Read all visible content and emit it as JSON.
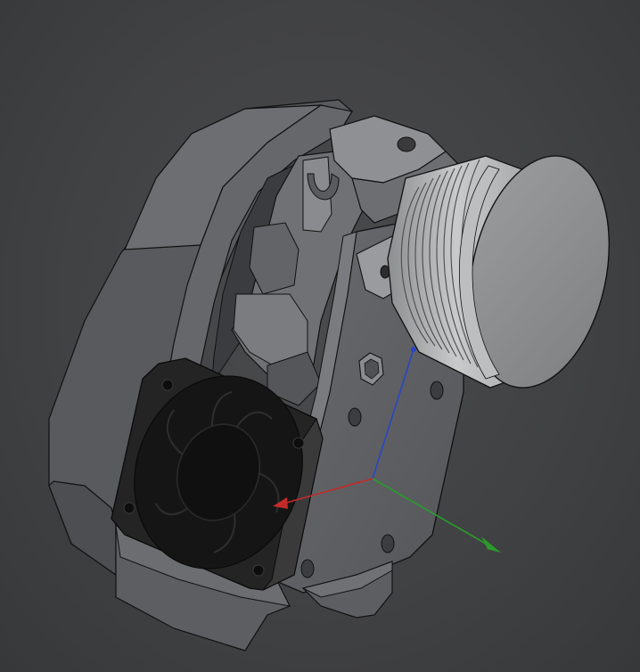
{
  "viewport": {
    "background_color": "#424345",
    "model": {
      "body_color": "#5f6063",
      "body_dark": "#4a4b4e",
      "body_light": "#77787b",
      "motor_color": "#a8a9ab",
      "motor_face": "#8e8f91",
      "fan_color": "#1c1c1c",
      "edge_color": "#111111"
    },
    "axes": {
      "x_color": "#c42a2a",
      "y_color": "#2b9b2b",
      "z_color": "#2846c4"
    }
  }
}
